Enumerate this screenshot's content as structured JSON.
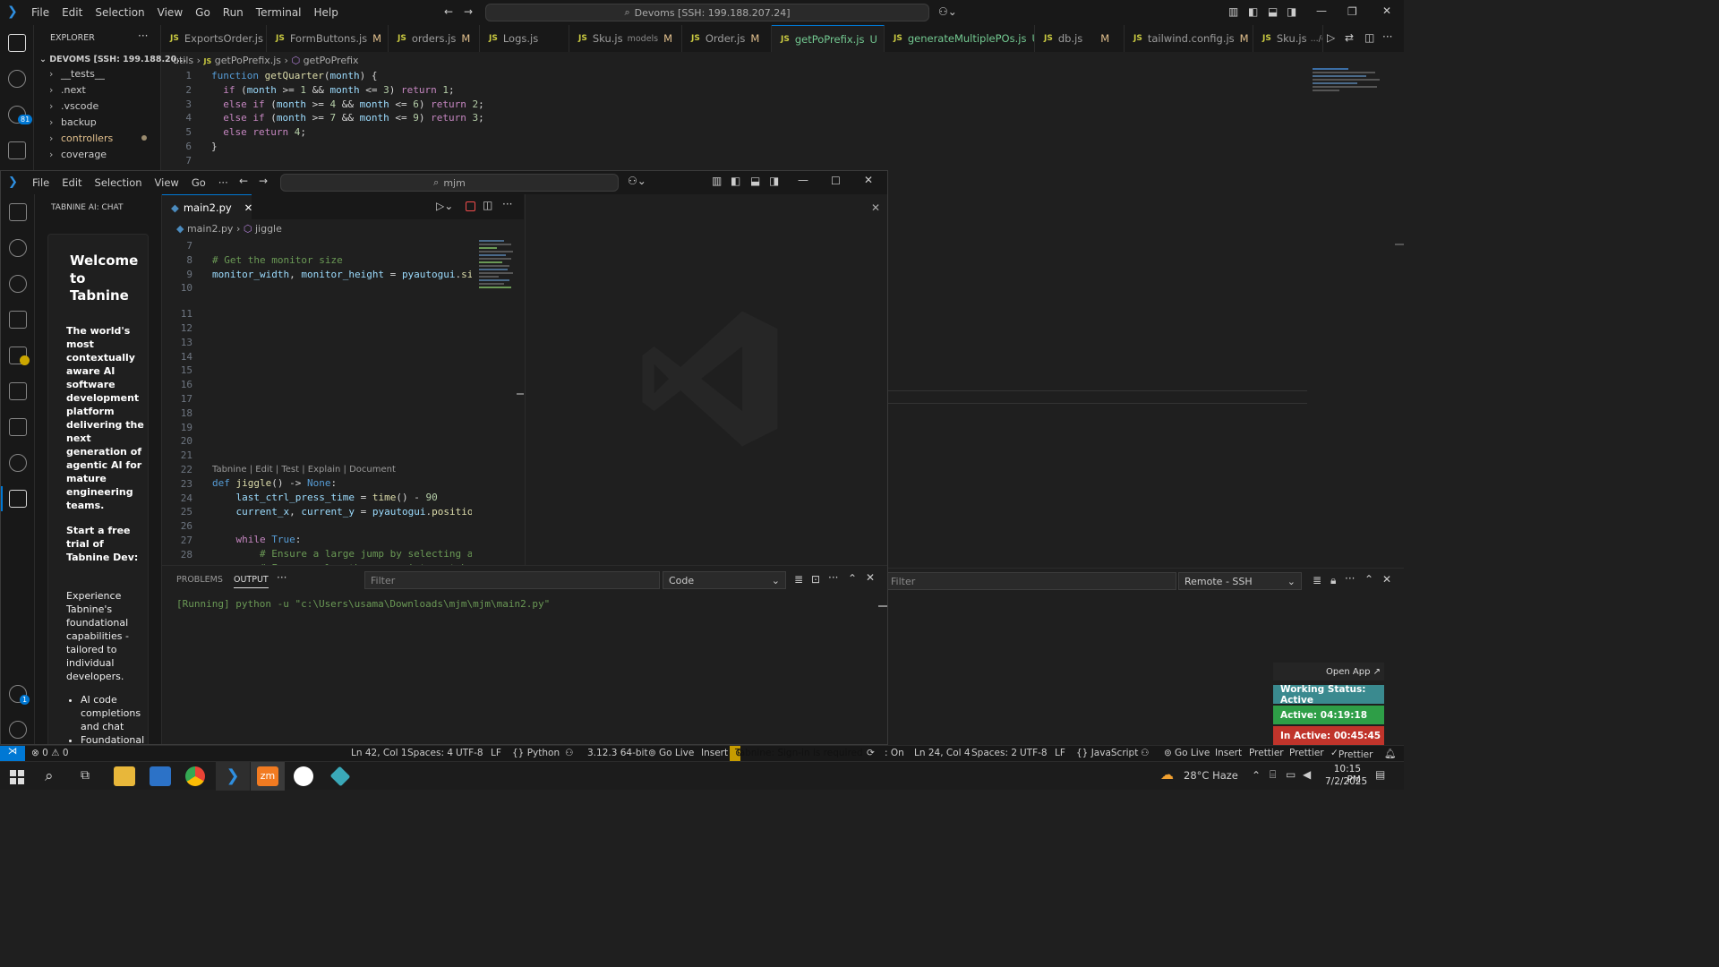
{
  "back_window": {
    "menu": [
      "File",
      "Edit",
      "Selection",
      "View",
      "Go",
      "Run",
      "Terminal",
      "Help"
    ],
    "command_center": "Devoms [SSH: 199.188.207.24]",
    "explorer_title": "EXPLORER",
    "explorer_root": "DEVOMS [SSH: 199.188.20...",
    "explorer_items": [
      "__tests__",
      ".next",
      ".vscode",
      "backup",
      "controllers",
      "coverage"
    ],
    "tabs": [
      {
        "label": "ExportsOrder.js",
        "mark": ""
      },
      {
        "label": "FormButtons.js",
        "mark": "M"
      },
      {
        "label": "orders.js",
        "mark": "M"
      },
      {
        "label": "Logs.js",
        "mark": ""
      },
      {
        "label": "Sku.js",
        "sub": "models",
        "mark": "M"
      },
      {
        "label": "Order.js",
        "mark": "M"
      },
      {
        "label": "getPoPrefix.js",
        "mark": "U"
      },
      {
        "label": "generateMultiplePOs.js",
        "mark": "U"
      },
      {
        "label": "db.js",
        "mark": "M"
      },
      {
        "label": "tailwind.config.js",
        "mark": "M"
      },
      {
        "label": "Sku.js",
        "sub": ".../c",
        "mark": ""
      }
    ],
    "breadcrumb": [
      "utils",
      "getPoPrefix.js",
      "getPoPrefix"
    ],
    "scm_badge": "81",
    "code_lines": [
      "1",
      "2",
      "3",
      "4",
      "5",
      "6",
      "7"
    ]
  },
  "front_window": {
    "menu": [
      "File",
      "Edit",
      "Selection",
      "View",
      "Go"
    ],
    "command_center": "mjm",
    "side_title": "TABNINE AI: CHAT",
    "tabnine": {
      "welcome": "Welcome to Tabnine",
      "tagline": "The world's most contextually aware AI software development platform delivering the next generation of agentic AI for mature engineering teams.",
      "trial": "Start a free trial of Tabnine Dev:",
      "experience": "Experience Tabnine's foundational capabilities - tailored to individual developers.",
      "bullets": [
        "AI code completions and chat",
        "Foundational"
      ]
    },
    "tab_label": "main2.py",
    "breadcrumb": [
      "main2.py",
      "jiggle"
    ],
    "codelens": "Tabnine | Edit | Test | Explain | Document",
    "line_numbers": [
      "7",
      "8",
      "9",
      "10",
      "11",
      "12",
      "13",
      "14",
      "15",
      "16",
      "17",
      "18",
      "19",
      "20",
      "21",
      "22",
      "23",
      "24",
      "25",
      "26",
      "27",
      "28",
      "29"
    ],
    "panel_tabs": [
      "PROBLEMS",
      "OUTPUT"
    ],
    "filter_placeholder": "Filter",
    "output_channel": "Code",
    "output_line": "[Running] python -u \"c:\\Users\\usama\\Downloads\\mjm\\mjm\\main2.py\"",
    "account_badge": "1"
  },
  "right_panel": {
    "filter_placeholder": "Filter",
    "output_channel": "Remote - SSH",
    "open_app": "Open App ↗",
    "working_status": "Working Status: Active",
    "active_time": "Active: 04:19:18",
    "inactive_time": "In Active: 00:45:45",
    "status_colors": {
      "working": "#3a8a8f",
      "active": "#2e9e47",
      "inactive": "#c0342b"
    }
  },
  "status_bar": {
    "problems": "⊗ 0 ⚠ 0",
    "left_items": [
      "Ln 42, Col 1",
      "Spaces: 4",
      "UTF-8",
      "LF",
      "{} Python",
      "3.12.3 64-bit",
      "Go Live",
      "Insert"
    ],
    "tabnine": "Tabnine: Sign-in is required",
    "right_items": [
      ": On",
      "Ln 24, Col 4",
      "Spaces: 2",
      "UTF-8",
      "LF",
      "{} JavaScript",
      "Go Live",
      "Insert",
      "Prettier",
      "Prettier",
      "Prettier"
    ]
  },
  "taskbar": {
    "weather": "28°C  Haze",
    "time": "10:15 PM",
    "date": "7/2/2025"
  }
}
